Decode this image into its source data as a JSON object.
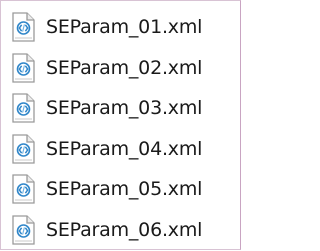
{
  "files": [
    {
      "name": "SEParam_01.xml",
      "icon": "xml-file-icon"
    },
    {
      "name": "SEParam_02.xml",
      "icon": "xml-file-icon"
    },
    {
      "name": "SEParam_03.xml",
      "icon": "xml-file-icon"
    },
    {
      "name": "SEParam_04.xml",
      "icon": "xml-file-icon"
    },
    {
      "name": "SEParam_05.xml",
      "icon": "xml-file-icon"
    },
    {
      "name": "SEParam_06.xml",
      "icon": "xml-file-icon"
    }
  ],
  "colors": {
    "icon_accent": "#2f86c9",
    "text": "#1a1a1a",
    "border": "#c9a4c2"
  }
}
